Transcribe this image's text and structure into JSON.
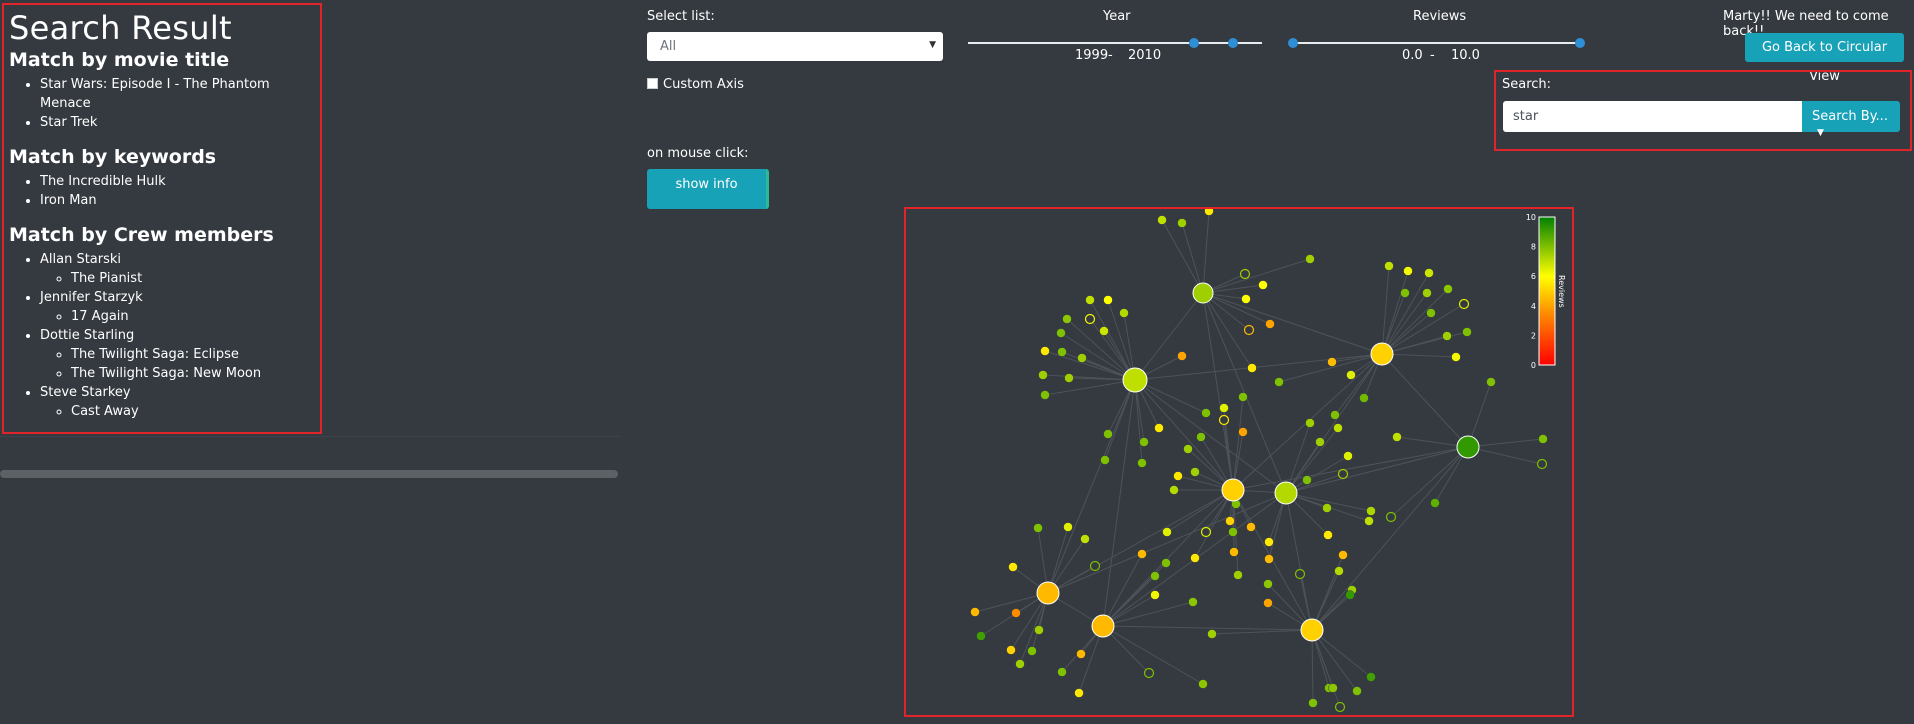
{
  "results": {
    "title": "Search Result",
    "sections": [
      {
        "heading": "Match by movie title",
        "items": [
          {
            "label": "Star Wars: Episode I - The Phantom Menace",
            "sub": []
          },
          {
            "label": "Star Trek",
            "sub": []
          }
        ]
      },
      {
        "heading": "Match by keywords",
        "items": [
          {
            "label": "The Incredible Hulk",
            "sub": []
          },
          {
            "label": "Iron Man",
            "sub": []
          }
        ]
      },
      {
        "heading": "Match by Crew members",
        "items": [
          {
            "label": "Allan Starski",
            "sub": [
              "The Pianist"
            ]
          },
          {
            "label": "Jennifer Starzyk",
            "sub": [
              "17 Again"
            ]
          },
          {
            "label": "Dottie Starling",
            "sub": [
              "The Twilight Saga: Eclipse",
              "The Twilight Saga: New Moon"
            ]
          },
          {
            "label": "Steve Starkey",
            "sub": [
              "Cast Away"
            ]
          }
        ]
      }
    ]
  },
  "controls": {
    "select_list_label": "Select list:",
    "select_value": "All",
    "custom_axis_label": "Custom Axis",
    "custom_axis_checked": false,
    "mouse_click_label": "on mouse click:",
    "show_info_label": "show info",
    "year_label": "Year",
    "year_from": "1999",
    "year_dash": "-",
    "year_to": "2010",
    "reviews_label": "Reviews",
    "reviews_from": "0.0",
    "reviews_dash": "-",
    "reviews_to": "10.0",
    "marty_text": "Marty!! We need to come back!!",
    "go_back_label": "Go Back to Circular View",
    "search_label": "Search:",
    "search_value": "star",
    "search_by_label": "Search By..."
  },
  "legend": {
    "title": "Reviews",
    "ticks": [
      "10",
      "8",
      "6",
      "4",
      "2",
      "0"
    ]
  },
  "colors": {
    "accent": "#17a2b8",
    "highlight_border": "#e0242a",
    "background": "#343a40"
  }
}
